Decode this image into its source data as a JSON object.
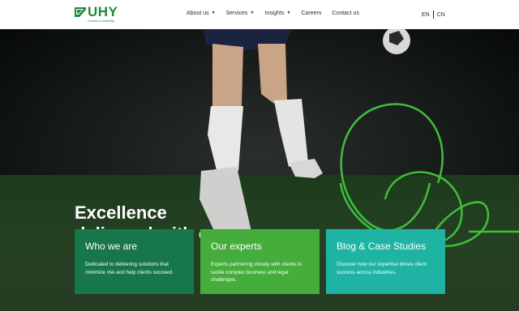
{
  "brand": {
    "name": "UHY",
    "tagline": "Connect to possibility",
    "color": "#1f8a3b"
  },
  "nav": {
    "items": [
      {
        "label": "About us",
        "has_menu": true
      },
      {
        "label": "Services",
        "has_menu": true
      },
      {
        "label": "Insights",
        "has_menu": true
      },
      {
        "label": "Careers",
        "has_menu": false
      },
      {
        "label": "Contact us",
        "has_menu": false
      }
    ],
    "languages": [
      "EN",
      "CN"
    ]
  },
  "hero": {
    "headline_line1": "Excellence",
    "headline_line2": "delivered with care",
    "accent_line_color": "#3fbf3a"
  },
  "cards": [
    {
      "title": "Who we are",
      "text": "Dedicated to delivering solutions that minimize risk and help clients succeed.",
      "color": "#17774a"
    },
    {
      "title": "Our experts",
      "text": "Experts partnering closely with clients to tackle complex business and legal challenges.",
      "color": "#45ad3c"
    },
    {
      "title": "Blog & Case Studies",
      "text": "Discover how our expertise drives client success across industries.",
      "color": "#1fb3a3"
    }
  ]
}
